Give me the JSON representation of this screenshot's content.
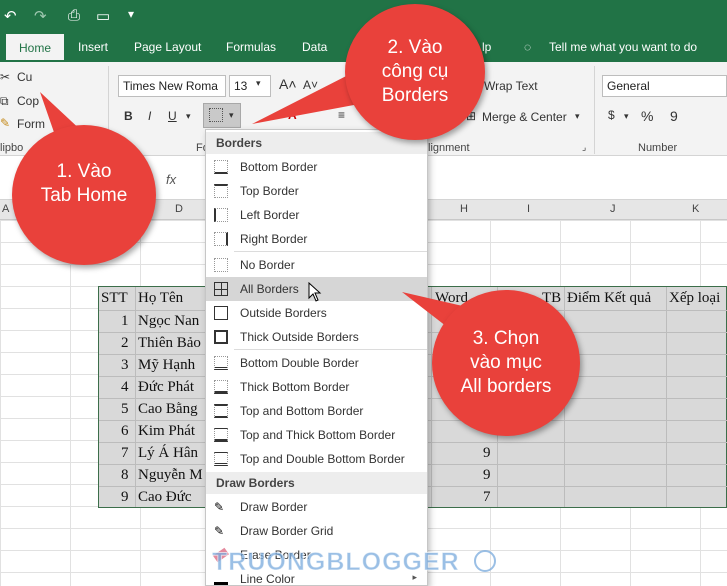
{
  "quick_access": {
    "save_icon": "undo-icon",
    "redo": "redo-icon"
  },
  "tabs": [
    "Home",
    "Insert",
    "Page Layout",
    "Formulas",
    "Data",
    "lp",
    "Tell me what you want to do"
  ],
  "ribbon": {
    "clipboard": {
      "cut": "Cu",
      "copy": "Cop",
      "format": "Form",
      "group": "lipbo"
    },
    "font": {
      "name": "Times New Roma",
      "size": "13",
      "bold": "B",
      "italic": "I",
      "underline": "U",
      "group_label": "Fo"
    },
    "alignment": {
      "wrap_text": "Wrap Text",
      "merge": "Merge & Center",
      "group_label": "lignment"
    },
    "number": {
      "format": "General",
      "dollar": "$",
      "percent": "%",
      "comma": "9",
      "group_label": "Number"
    }
  },
  "formula_bar": {
    "fx": "fx"
  },
  "columns": {
    "left": [
      "A",
      "D"
    ],
    "right": [
      "H",
      "I",
      "J",
      "K"
    ]
  },
  "table": {
    "header": [
      "STT",
      "Họ Tên",
      "Word",
      "TB",
      "Điểm Kết quả",
      "Xếp loại"
    ],
    "rows": [
      {
        "stt": "1",
        "name": "Ngọc Nan",
        "word": ""
      },
      {
        "stt": "2",
        "name": "Thiên Bảo",
        "word": ""
      },
      {
        "stt": "3",
        "name": "Mỹ Hạnh",
        "word": ""
      },
      {
        "stt": "4",
        "name": "Đức Phát",
        "word": ""
      },
      {
        "stt": "5",
        "name": "Cao Bằng",
        "word": ""
      },
      {
        "stt": "6",
        "name": "Kim Phát",
        "word": ""
      },
      {
        "stt": "7",
        "name": "Lý Á Hân",
        "word": "9"
      },
      {
        "stt": "8",
        "name": "Nguyễn M",
        "word": "9"
      },
      {
        "stt": "9",
        "name": "Cao Đức",
        "word": "7"
      }
    ]
  },
  "dropdown": {
    "section1": "Borders",
    "items1": [
      "Bottom Border",
      "Top Border",
      "Left Border",
      "Right Border"
    ],
    "items2": [
      "No Border",
      "All Borders",
      "Outside Borders",
      "Thick Outside Borders"
    ],
    "items3": [
      "Bottom Double Border",
      "Thick Bottom Border",
      "Top and Bottom Border",
      "Top and Thick Bottom Border",
      "Top and Double Bottom Border"
    ],
    "section2": "Draw Borders",
    "items4": [
      "Draw Border",
      "Draw Border Grid",
      "Erase Border",
      "Line Color"
    ]
  },
  "callouts": {
    "c1": [
      "1. Vào",
      "Tab Home"
    ],
    "c2": [
      "2. Vào",
      "công cụ",
      "Borders"
    ],
    "c3": [
      "3. Chọn",
      "vào mục",
      "All borders"
    ]
  },
  "watermark": "TRUONGBLOGGER",
  "colors": {
    "excel_green": "#217346",
    "callout_red": "#e9413b"
  }
}
